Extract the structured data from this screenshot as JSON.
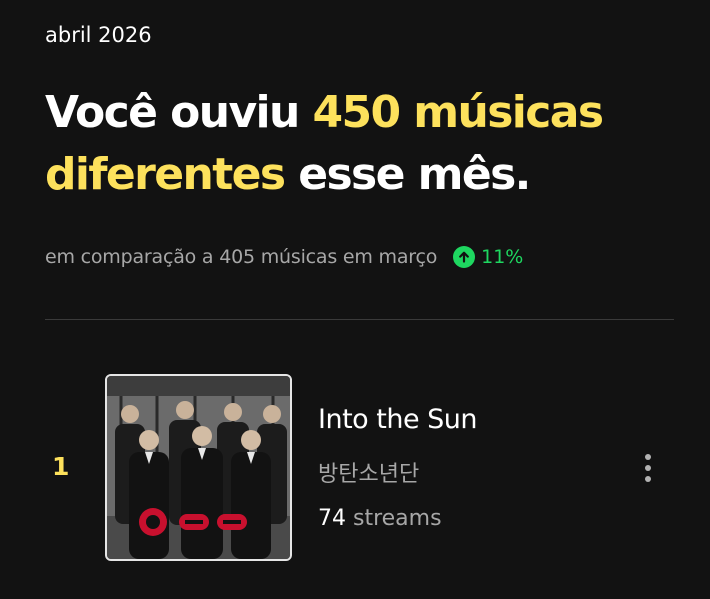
{
  "period": "abril 2026",
  "headline": {
    "prefix": "Você ouviu ",
    "highlight_1": "450 músicas",
    "highlight_2": "diferentes",
    "suffix": " esse mês."
  },
  "comparison": {
    "text": "em comparação a 405 músicas em março",
    "trend_value": "11%",
    "trend_direction": "up",
    "trend_icon": "arrow-up-circle-icon",
    "trend_color": "#1ed760"
  },
  "colors": {
    "background": "#121212",
    "highlight": "#fde15c",
    "secondary_text": "#a7a7a7"
  },
  "top_tracks": [
    {
      "rank": "1",
      "title": "Into the Sun",
      "artist": "방탄소년단",
      "streams_count": "74",
      "streams_label": " streams",
      "menu_icon": "more-vertical-icon"
    }
  ]
}
